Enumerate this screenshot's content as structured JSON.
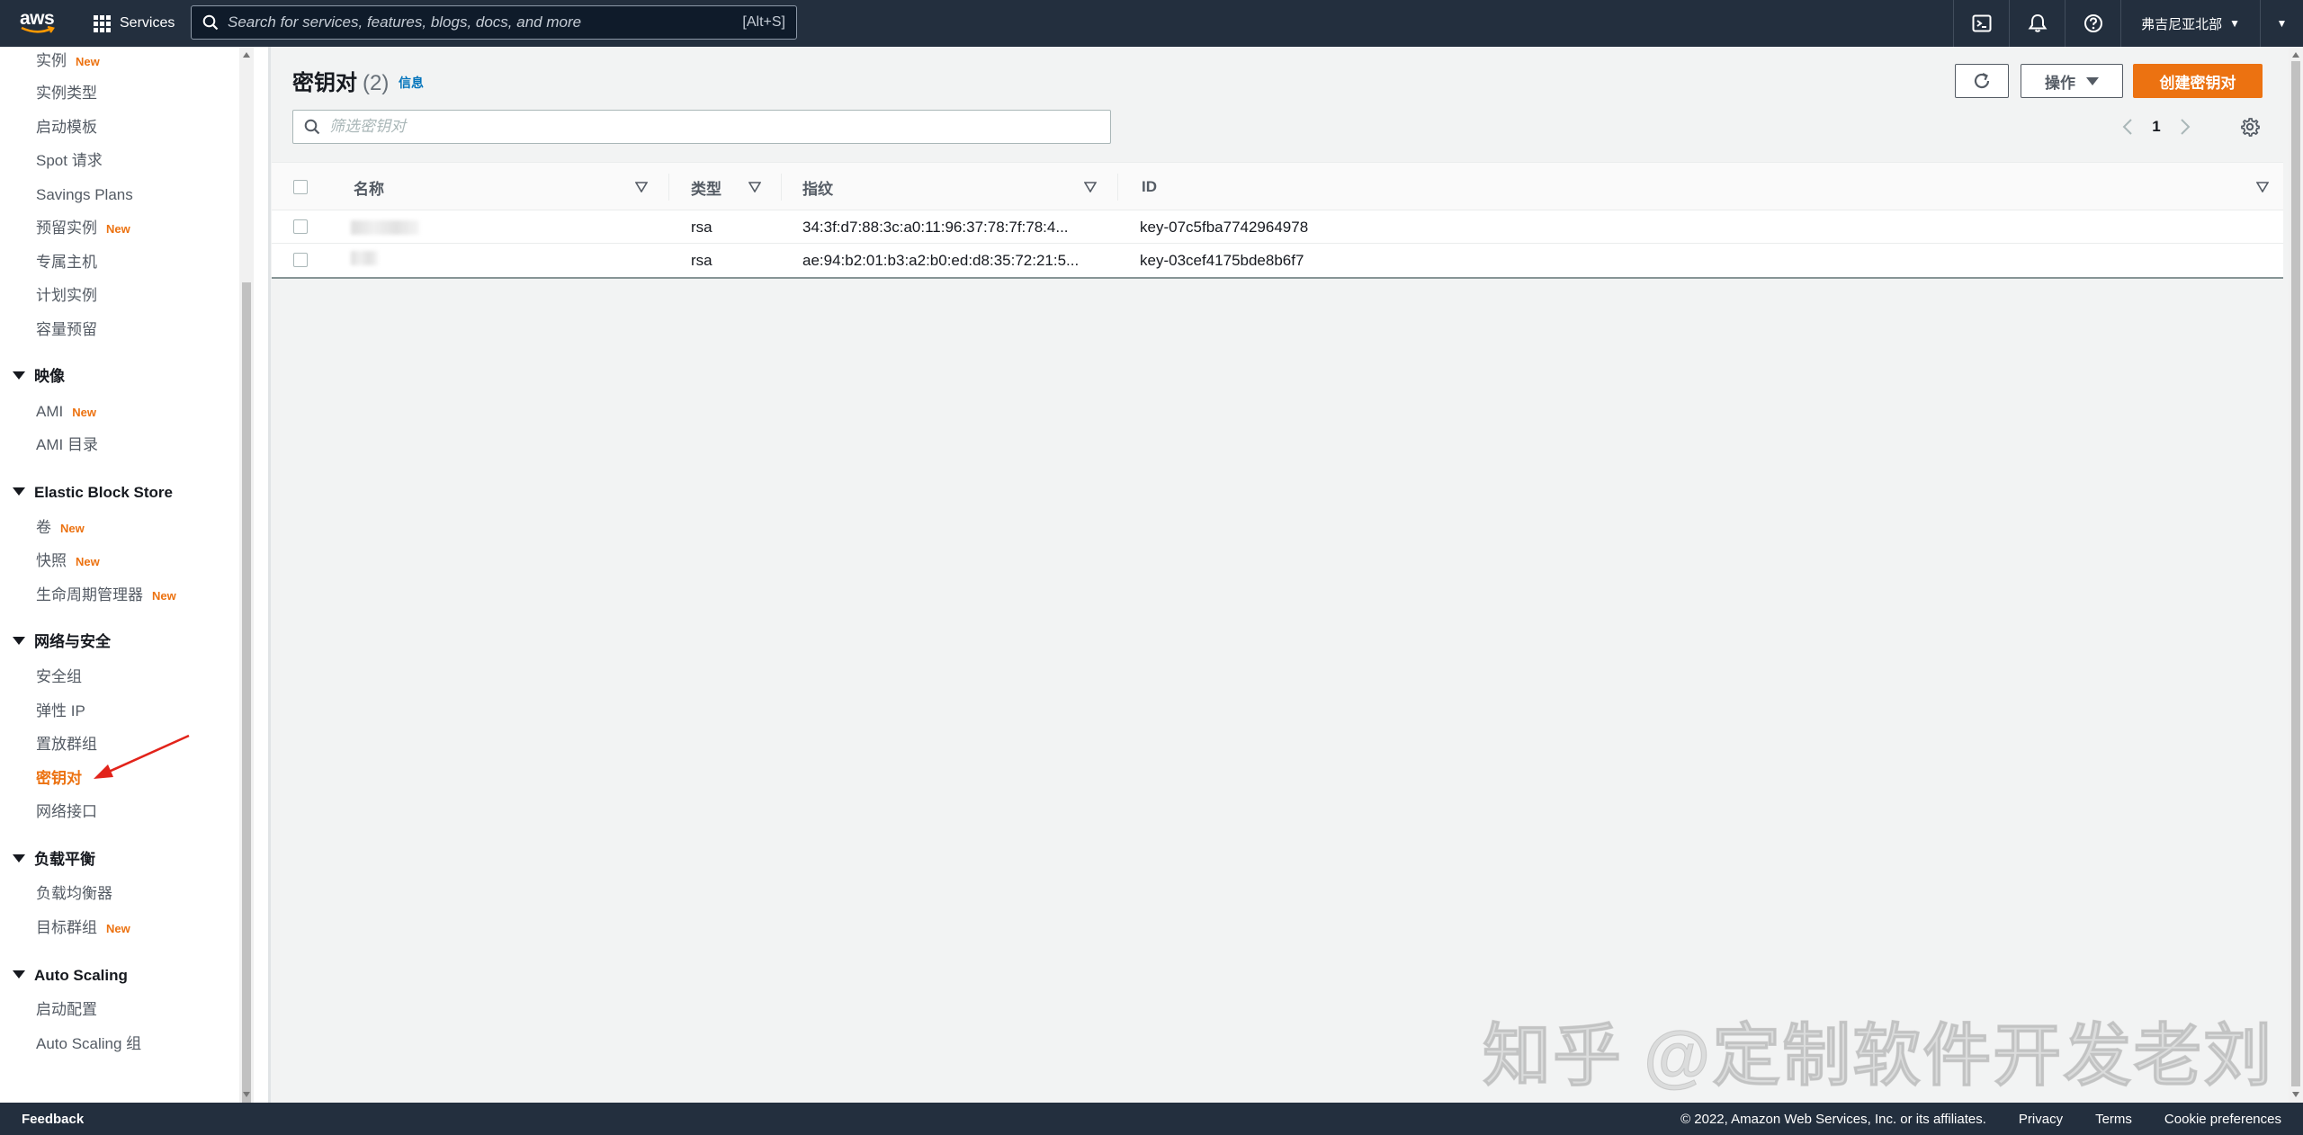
{
  "topnav": {
    "logo_text": "aws",
    "services_label": "Services",
    "search_placeholder": "Search for services, features, blogs, docs, and more",
    "search_shortcut": "[Alt+S]",
    "region": "弗吉尼亚北部"
  },
  "sidebar": {
    "top_items": [
      {
        "label": "实例",
        "new": "New"
      },
      {
        "label": "实例类型",
        "new": ""
      },
      {
        "label": "启动模板",
        "new": ""
      },
      {
        "label": "Spot 请求",
        "new": ""
      },
      {
        "label": "Savings Plans",
        "new": ""
      },
      {
        "label": "预留实例",
        "new": "New"
      },
      {
        "label": "专属主机",
        "new": ""
      },
      {
        "label": "计划实例",
        "new": ""
      },
      {
        "label": "容量预留",
        "new": ""
      }
    ],
    "images_heading": "映像",
    "images_items": [
      {
        "label": "AMI",
        "new": "New"
      },
      {
        "label": "AMI 目录",
        "new": ""
      }
    ],
    "ebs_heading": "Elastic Block Store",
    "ebs_items": [
      {
        "label": "卷",
        "new": "New"
      },
      {
        "label": "快照",
        "new": "New"
      },
      {
        "label": "生命周期管理器",
        "new": "New"
      }
    ],
    "network_heading": "网络与安全",
    "network_items": [
      {
        "label": "安全组"
      },
      {
        "label": "弹性 IP"
      },
      {
        "label": "置放群组"
      },
      {
        "label": "密钥对",
        "active": true
      },
      {
        "label": "网络接口"
      }
    ],
    "lb_heading": "负载平衡",
    "lb_items": [
      {
        "label": "负载均衡器",
        "new": ""
      },
      {
        "label": "目标群组",
        "new": "New"
      }
    ],
    "as_heading": "Auto Scaling",
    "as_items": [
      {
        "label": "启动配置"
      },
      {
        "label": "Auto Scaling 组"
      }
    ]
  },
  "main": {
    "title": "密钥对",
    "count": "(2)",
    "info_link": "信息",
    "actions_label": "操作",
    "create_label": "创建密钥对",
    "filter_placeholder": "筛选密钥对",
    "page_number": "1",
    "columns": [
      "名称",
      "类型",
      "指纹",
      "ID"
    ],
    "rows": [
      {
        "type": "rsa",
        "fingerprint": "34:3f:d7:88:3c:a0:11:96:37:78:7f:78:4...",
        "id": "key-07c5fba7742964978"
      },
      {
        "type": "rsa",
        "fingerprint": "ae:94:b2:01:b3:a2:b0:ed:d8:35:72:21:5...",
        "id": "key-03cef4175bde8b6f7"
      }
    ]
  },
  "watermark": "知乎 @定制软件开发老刘",
  "footer": {
    "feedback": "Feedback",
    "copyright": "© 2022, Amazon Web Services, Inc. or its affiliates.",
    "privacy": "Privacy",
    "terms": "Terms",
    "cookies": "Cookie preferences"
  },
  "colors": {
    "nav_bg": "#232f3e",
    "accent": "#ec7211",
    "link": "#0073bb"
  }
}
